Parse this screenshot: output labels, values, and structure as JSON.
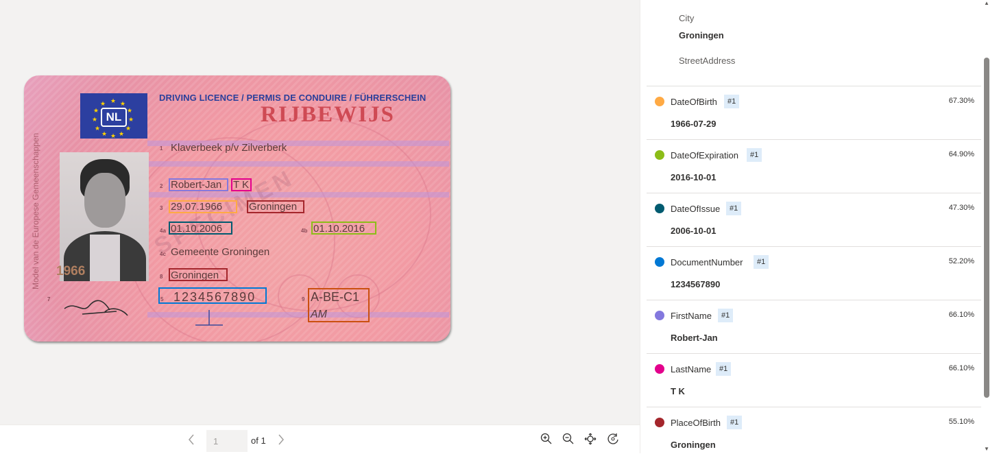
{
  "document": {
    "card_header": "DRIVING LICENCE / PERMIS DE CONDUIRE / FÜHRERSCHEIN",
    "card_title": "RIJBEWIJS",
    "country_code": "NL",
    "side_text": "Model van de Europese Gemeenschappen",
    "photo_year": "1966",
    "field_numbers": [
      "1",
      "2",
      "3",
      "4a",
      "4b",
      "4c",
      "8",
      "5",
      "9",
      "7"
    ],
    "surname_line": "Klaverbeek p/v Zilverberk",
    "given_names": "Robert-Jan",
    "initials": "T K",
    "birth_date": "29.07.1966",
    "birth_place": "Groningen",
    "issue_date": "01.10.2006",
    "expiry_date": "01.10.2016",
    "authority": "Gemeente Groningen",
    "residence": "Groningen",
    "doc_number": "1234567890",
    "categories": "A-BE-C1",
    "categories2": "AM",
    "watermark": "SPECIMEN"
  },
  "toolbar": {
    "prev_icon": "chevron-left-icon",
    "next_icon": "chevron-right-icon",
    "page_value": "1",
    "of_pages": "of 1",
    "zoom_in_icon": "zoom-in-icon",
    "zoom_out_icon": "zoom-out-icon",
    "fit_icon": "fit-to-page-icon",
    "rotate_icon": "rotate-icon"
  },
  "address": {
    "city_label": "City",
    "city_value": "Groningen",
    "street_label": "StreetAddress"
  },
  "fields": [
    {
      "name": "DateOfBirth",
      "badge": "#1",
      "confidence": "67.30%",
      "value": "1966-07-29",
      "color": "#ffaa44"
    },
    {
      "name": "DateOfExpiration",
      "badge": "#1",
      "confidence": "64.90%",
      "value": "2016-10-01",
      "color": "#8cbd18"
    },
    {
      "name": "DateOfIssue",
      "badge": "#1",
      "confidence": "47.30%",
      "value": "2006-10-01",
      "color": "#005b70"
    },
    {
      "name": "DocumentNumber",
      "badge": "#1",
      "confidence": "52.20%",
      "value": "1234567890",
      "color": "#0078d4"
    },
    {
      "name": "FirstName",
      "badge": "#1",
      "confidence": "66.10%",
      "value": "Robert-Jan",
      "color": "#8378de"
    },
    {
      "name": "LastName",
      "badge": "#1",
      "confidence": "66.10%",
      "value": "T K",
      "color": "#e3008c"
    },
    {
      "name": "PlaceOfBirth",
      "badge": "#1",
      "confidence": "55.10%",
      "value": "Groningen",
      "color": "#a4262c"
    }
  ]
}
